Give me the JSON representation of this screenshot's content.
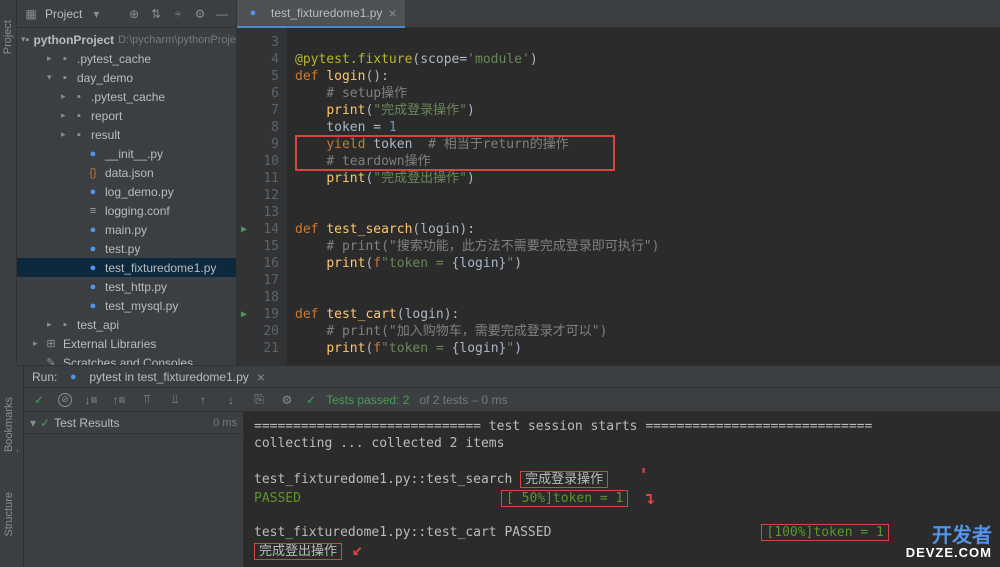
{
  "sidebar": {
    "title": "Project",
    "project_name": "pythonProject",
    "project_path": "D:\\pycharm\\pythonProject",
    "tree": [
      {
        "label": ".pytest_cache",
        "depth": 1,
        "type": "folder",
        "arrow": "▸"
      },
      {
        "label": "day_demo",
        "depth": 1,
        "type": "folder",
        "arrow": "▾"
      },
      {
        "label": ".pytest_cache",
        "depth": 2,
        "type": "folder",
        "arrow": "▸"
      },
      {
        "label": "report",
        "depth": 2,
        "type": "folder",
        "arrow": "▸"
      },
      {
        "label": "result",
        "depth": 2,
        "type": "folder",
        "arrow": "▸"
      },
      {
        "label": "__init__.py",
        "depth": 3,
        "type": "py"
      },
      {
        "label": "data.json",
        "depth": 3,
        "type": "json"
      },
      {
        "label": "log_demo.py",
        "depth": 3,
        "type": "py"
      },
      {
        "label": "logging.conf",
        "depth": 3,
        "type": "txt"
      },
      {
        "label": "main.py",
        "depth": 3,
        "type": "py"
      },
      {
        "label": "test.py",
        "depth": 3,
        "type": "py"
      },
      {
        "label": "test_fixturedome1.py",
        "depth": 3,
        "type": "py",
        "sel": true
      },
      {
        "label": "test_http.py",
        "depth": 3,
        "type": "py"
      },
      {
        "label": "test_mysql.py",
        "depth": 3,
        "type": "py"
      },
      {
        "label": "test_api",
        "depth": 1,
        "type": "folder",
        "arrow": "▸"
      },
      {
        "label": "External Libraries",
        "depth": 0,
        "type": "lib",
        "arrow": "▸"
      },
      {
        "label": "Scratches and Consoles",
        "depth": 0,
        "type": "scratch"
      }
    ]
  },
  "tab": {
    "filename": "test_fixturedome1.py"
  },
  "code_lines": [
    {
      "n": 3,
      "html": ""
    },
    {
      "n": 4,
      "html": "<span class='dec'>@pytest.fixture</span>(<span class='param'>scope</span>=<span class='str'>'module'</span>)"
    },
    {
      "n": 5,
      "html": "<span class='kw'>def </span><span class='fn'>login</span>():"
    },
    {
      "n": 6,
      "html": "    <span class='cmt'># setup操作</span>"
    },
    {
      "n": 7,
      "html": "    <span class='fn'>print</span>(<span class='str'>\"完成登录操作\"</span>)"
    },
    {
      "n": 8,
      "html": "    token = <span class='num'>1</span>"
    },
    {
      "n": 9,
      "html": "    <span class='kw'>yield</span> token  <span class='cmt'># 相当于return的操作</span>"
    },
    {
      "n": 10,
      "html": "    <span class='cmt'># teardown操作</span>"
    },
    {
      "n": 11,
      "html": "    <span class='fn'>print</span>(<span class='str'>\"完成登出操作\"</span>)"
    },
    {
      "n": 12,
      "html": ""
    },
    {
      "n": 13,
      "html": ""
    },
    {
      "n": 14,
      "html": "<span class='kw'>def </span><span class='fn'>test_search</span>(login):",
      "run": true
    },
    {
      "n": 15,
      "html": "    <span class='cmt'># print(\"搜索功能，此方法不需要完成登录即可执行\")</span>"
    },
    {
      "n": 16,
      "html": "    <span class='fn'>print</span>(<span class='kw'>f</span><span class='str'>\"token = </span>{login}<span class='str'>\"</span>)"
    },
    {
      "n": 17,
      "html": ""
    },
    {
      "n": 18,
      "html": ""
    },
    {
      "n": 19,
      "html": "<span class='kw'>def </span><span class='fn'>test_cart</span>(login):",
      "run": true
    },
    {
      "n": 20,
      "html": "    <span class='cmt'># print(\"加入购物车，需要完成登录才可以\")</span>"
    },
    {
      "n": 21,
      "html": "    <span class='fn'>print</span>(<span class='kw'>f</span><span class='str'>\"token = </span>{login}<span class='str'>\"</span>)"
    }
  ],
  "run": {
    "label": "Run:",
    "tab": "pytest in test_fixturedome1.py",
    "tests_passed_label": "Tests passed: 2",
    "tests_total_label": " of 2 tests – 0 ms",
    "results_label": "Test Results",
    "results_time": "0 ms"
  },
  "console": {
    "l1": "============================= test session starts =============================",
    "l2": "collecting ... collected 2 items",
    "l3a": "test_fixturedome1.py::test_search ",
    "l3b": "完成登录操作",
    "l4a": "PASSED",
    "l4b": "[ 50%]token = 1",
    "l5": "test_fixturedome1.py::test_cart PASSED",
    "l5b": "[100%]token = 1",
    "l6": "完成登出操作"
  },
  "left_tabs": {
    "project": "Project",
    "bookmarks": "Bookmarks",
    "structure": "Structure"
  },
  "watermark": {
    "line1": "开发者",
    "line2": "DEVZE.COM"
  }
}
